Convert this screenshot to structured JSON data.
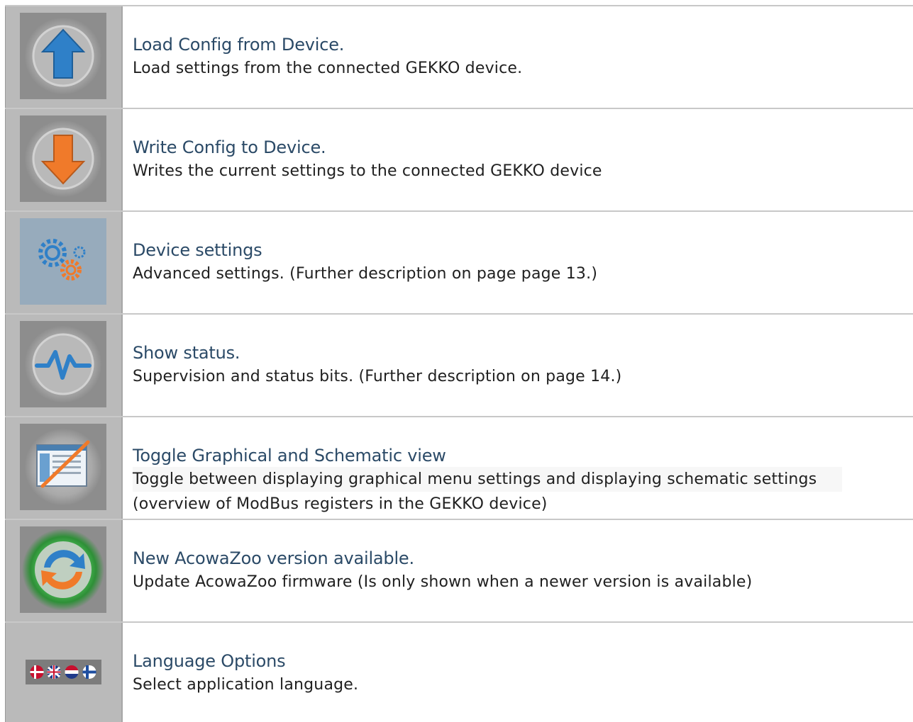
{
  "items": [
    {
      "title": "Load Config from Device.",
      "desc": "Load settings from the connected GEKKO device.",
      "icon": "upload-arrow-icon",
      "accent": "#2f80c8"
    },
    {
      "title": "Write Config to Device.",
      "desc": "Writes the current settings to the connected GEKKO device",
      "icon": "download-arrow-icon",
      "accent": "#f07a2a"
    },
    {
      "title": "Device settings",
      "desc": "Advanced settings. (Further description on page page 13.)",
      "icon": "gears-icon",
      "accent": "#2f80c8"
    },
    {
      "title": "Show status.",
      "desc": "Supervision and status bits. (Further description on page 14.)",
      "icon": "pulse-icon",
      "accent": "#2f80c8"
    },
    {
      "title": "Toggle Graphical and Schematic view",
      "desc_line1": "Toggle between displaying graphical menu settings and displaying schematic settings",
      "desc_line2": "(overview of ModBus registers in the GEKKO device)",
      "icon": "toggle-view-icon",
      "accent": "#f07a2a"
    },
    {
      "title": "New AcowaZoo version available.",
      "desc": "Update AcowaZoo firmware (Is only shown when a newer version is available)",
      "icon": "update-sync-icon",
      "accent": "#3fbf4a"
    },
    {
      "title": "Language Options",
      "desc": "Select application language.",
      "icon": "language-flags-icon",
      "accent": "#c8102e"
    }
  ]
}
